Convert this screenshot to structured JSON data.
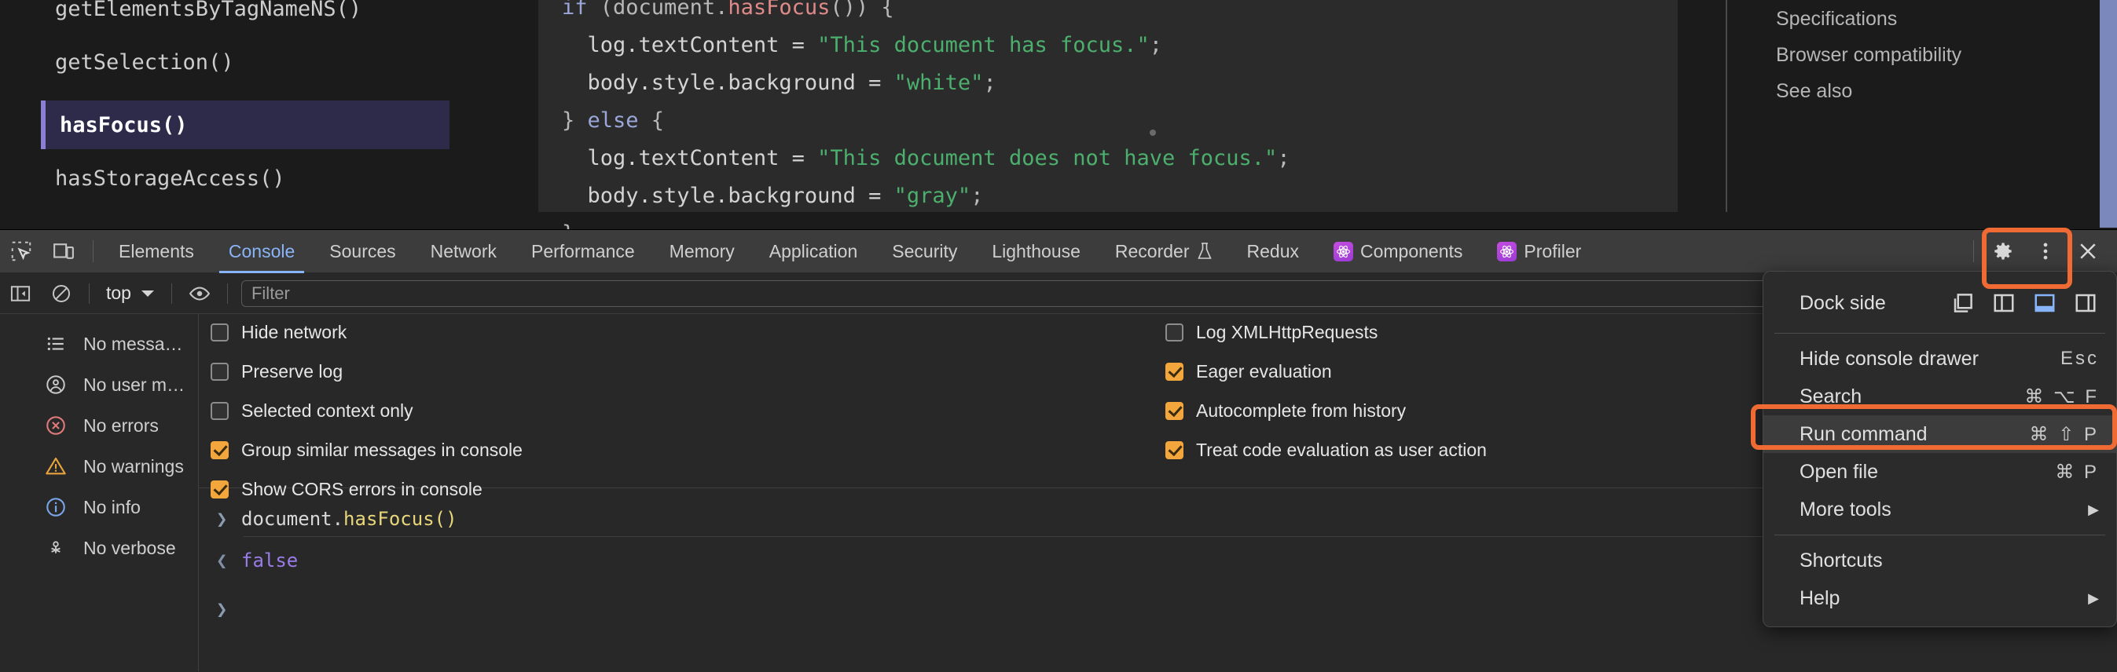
{
  "mdn": {
    "sidebar_items": [
      {
        "label": "getElementsByTagNameNS()"
      },
      {
        "label": "getSelection()"
      },
      {
        "label": "hasFocus()"
      },
      {
        "label": "hasStorageAccess()"
      }
    ],
    "code_lines": [
      {
        "parts": [
          {
            "t": "if ",
            "c": "kw"
          },
          {
            "t": "(document.",
            "c": "pun"
          },
          {
            "t": "hasFocus",
            "c": "fn"
          },
          {
            "t": "()) {",
            "c": "pun"
          }
        ]
      },
      {
        "parts": [
          {
            "t": "  log.textContent = ",
            "c": "prop"
          },
          {
            "t": "\"This document has focus.\"",
            "c": "str"
          },
          {
            "t": ";",
            "c": "pun"
          }
        ]
      },
      {
        "parts": [
          {
            "t": "  body.style.background = ",
            "c": "prop"
          },
          {
            "t": "\"white\"",
            "c": "str"
          },
          {
            "t": ";",
            "c": "pun"
          }
        ]
      },
      {
        "parts": [
          {
            "t": "} ",
            "c": "pun"
          },
          {
            "t": "else",
            "c": "kw"
          },
          {
            "t": " {",
            "c": "pun"
          }
        ]
      },
      {
        "parts": [
          {
            "t": "  log.textContent = ",
            "c": "prop"
          },
          {
            "t": "\"This document does not have focus.\"",
            "c": "str"
          },
          {
            "t": ";",
            "c": "pun"
          }
        ]
      },
      {
        "parts": [
          {
            "t": "  body.style.background = ",
            "c": "prop"
          },
          {
            "t": "\"gray\"",
            "c": "str"
          },
          {
            "t": ";",
            "c": "pun"
          }
        ]
      },
      {
        "parts": [
          {
            "t": "}",
            "c": "pun"
          }
        ]
      }
    ],
    "toc_items": [
      {
        "label": "Specifications"
      },
      {
        "label": "Browser compatibility"
      },
      {
        "label": "See also"
      }
    ]
  },
  "devtools": {
    "tabs": [
      {
        "label": "Elements",
        "active": false,
        "icon": ""
      },
      {
        "label": "Console",
        "active": true,
        "icon": ""
      },
      {
        "label": "Sources",
        "active": false,
        "icon": ""
      },
      {
        "label": "Network",
        "active": false,
        "icon": ""
      },
      {
        "label": "Performance",
        "active": false,
        "icon": ""
      },
      {
        "label": "Memory",
        "active": false,
        "icon": ""
      },
      {
        "label": "Application",
        "active": false,
        "icon": ""
      },
      {
        "label": "Security",
        "active": false,
        "icon": ""
      },
      {
        "label": "Lighthouse",
        "active": false,
        "icon": ""
      },
      {
        "label": "Recorder",
        "active": false,
        "icon": "flask-icon"
      },
      {
        "label": "Redux",
        "active": false,
        "icon": ""
      },
      {
        "label": "Components",
        "active": false,
        "icon": "react-badge-icon"
      },
      {
        "label": "Profiler",
        "active": false,
        "icon": "react-badge-icon"
      }
    ],
    "toolbar_right_icons": [
      "gear-icon",
      "more-vertical-icon",
      "close-icon"
    ],
    "console_toolbar": {
      "context_value": "top",
      "filter_placeholder": "Filter",
      "icons": [
        "toggle-sidebar-icon",
        "clear-console-icon",
        "eye-icon"
      ]
    },
    "console_sidebar": [
      {
        "icon": "list-icon",
        "label": "No messa…"
      },
      {
        "icon": "user-icon",
        "label": "No user m…"
      },
      {
        "icon": "error-icon",
        "label": "No errors"
      },
      {
        "icon": "warning-icon",
        "label": "No warnings"
      },
      {
        "icon": "info-icon",
        "label": "No info"
      },
      {
        "icon": "verbose-icon",
        "label": "No verbose"
      }
    ],
    "settings_left": [
      {
        "label": "Hide network",
        "checked": false
      },
      {
        "label": "Preserve log",
        "checked": false
      },
      {
        "label": "Selected context only",
        "checked": false
      },
      {
        "label": "Group similar messages in console",
        "checked": true
      },
      {
        "label": "Show CORS errors in console",
        "checked": true
      }
    ],
    "settings_right": [
      {
        "label": "Log XMLHttpRequests",
        "checked": false
      },
      {
        "label": "Eager evaluation",
        "checked": true
      },
      {
        "label": "Autocomplete from history",
        "checked": true
      },
      {
        "label": "Treat code evaluation as user action",
        "checked": true
      }
    ],
    "console_output": {
      "input_prefix": "document.",
      "input_fn": "hasFocus()",
      "return_value": "false",
      "prompt_caret": "❯",
      "return_caret": "❮"
    },
    "menu": {
      "dock_side_label": "Dock side",
      "dock_options": [
        {
          "name": "undock-icon",
          "selected": false
        },
        {
          "name": "dock-left-icon",
          "selected": false
        },
        {
          "name": "dock-bottom-icon",
          "selected": true
        },
        {
          "name": "dock-right-icon",
          "selected": false
        }
      ],
      "items": [
        {
          "label": "Hide console drawer",
          "shortcut": "Esc",
          "arrow": false,
          "highlight": false
        },
        {
          "label": "Search",
          "shortcut": "⌘ ⌥ F",
          "arrow": false,
          "highlight": false
        },
        {
          "label": "Run command",
          "shortcut": "⌘ ⇧ P",
          "arrow": false,
          "highlight": true
        },
        {
          "label": "Open file",
          "shortcut": "⌘ P",
          "arrow": false,
          "highlight": false
        },
        {
          "label": "More tools",
          "shortcut": "",
          "arrow": true,
          "highlight": false
        }
      ],
      "items2": [
        {
          "label": "Shortcuts",
          "shortcut": "",
          "arrow": false,
          "highlight": false
        },
        {
          "label": "Help",
          "shortcut": "",
          "arrow": true,
          "highlight": false
        }
      ]
    }
  },
  "colors": {
    "accent_blue": "#8ab4f8",
    "checkbox_on": "#f2a63b",
    "highlight_orange": "#f06a33",
    "devtools_bg": "#282828",
    "tabbar_bg": "#3c3c3c"
  }
}
